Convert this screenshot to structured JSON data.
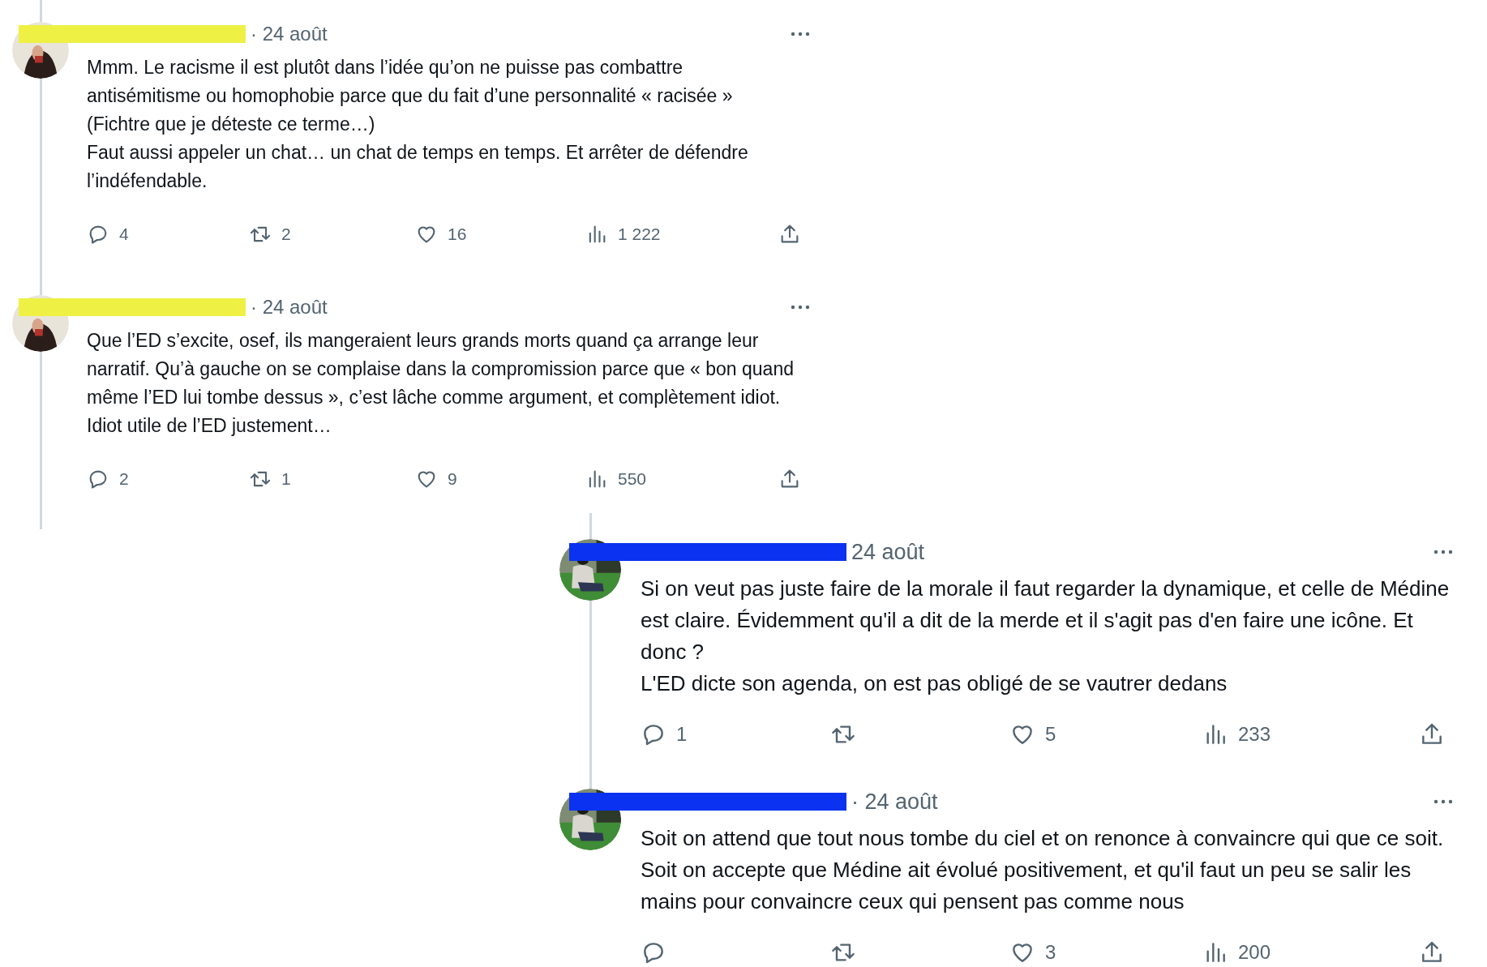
{
  "left_thread": [
    {
      "date": "· 24 août",
      "text": "Mmm. Le racisme il est plutôt dans l’idée qu’on ne puisse pas combattre antisémitisme ou homophobie parce que du fait d’une personnalité « racisée » (Fichtre que je déteste ce terme…)\nFaut aussi appeler un chat… un chat de temps en temps. Et arrêter de défendre l’indéfendable.",
      "actions": [
        {
          "kind": "reply",
          "count": "4"
        },
        {
          "kind": "repost",
          "count": "2"
        },
        {
          "kind": "like",
          "count": "16"
        },
        {
          "kind": "views",
          "count": "1 222"
        },
        {
          "kind": "share"
        }
      ]
    },
    {
      "date": "· 24 août",
      "text": "Que l’ED s’excite, osef, ils mangeraient leurs grands morts quand ça arrange leur narratif. Qu’à gauche on se complaise dans la compromission parce que « bon quand même l’ED lui tombe dessus », c’est lâche comme argument, et complètement idiot. Idiot utile de l’ED justement…",
      "actions": [
        {
          "kind": "reply",
          "count": "2"
        },
        {
          "kind": "repost",
          "count": "1"
        },
        {
          "kind": "like",
          "count": "9"
        },
        {
          "kind": "views",
          "count": "550"
        },
        {
          "kind": "share"
        }
      ]
    }
  ],
  "right_thread": [
    {
      "date": "24 août",
      "text": "Si on veut pas juste faire de la morale il faut regarder la dynamique, et celle de Médine est claire. Évidemment qu'il a dit de la merde et il s'agit pas d'en faire une icône. Et donc ?\nL'ED dicte son agenda, on est pas obligé de se vautrer dedans",
      "actions": [
        {
          "kind": "reply",
          "count": "1"
        },
        {
          "kind": "repost"
        },
        {
          "kind": "like",
          "count": "5"
        },
        {
          "kind": "views",
          "count": "233"
        },
        {
          "kind": "share"
        }
      ]
    },
    {
      "date": "· 24 août",
      "text": "Soit on attend que tout nous tombe du ciel et on renonce à convaincre qui que ce soit. Soit on accepte que Médine ait évolué positivement, et qu'il faut un peu se salir les mains pour convaincre ceux qui pensent pas comme nous",
      "actions": [
        {
          "kind": "reply"
        },
        {
          "kind": "repost"
        },
        {
          "kind": "like",
          "count": "3"
        },
        {
          "kind": "views",
          "count": "200"
        },
        {
          "kind": "share"
        }
      ]
    }
  ]
}
